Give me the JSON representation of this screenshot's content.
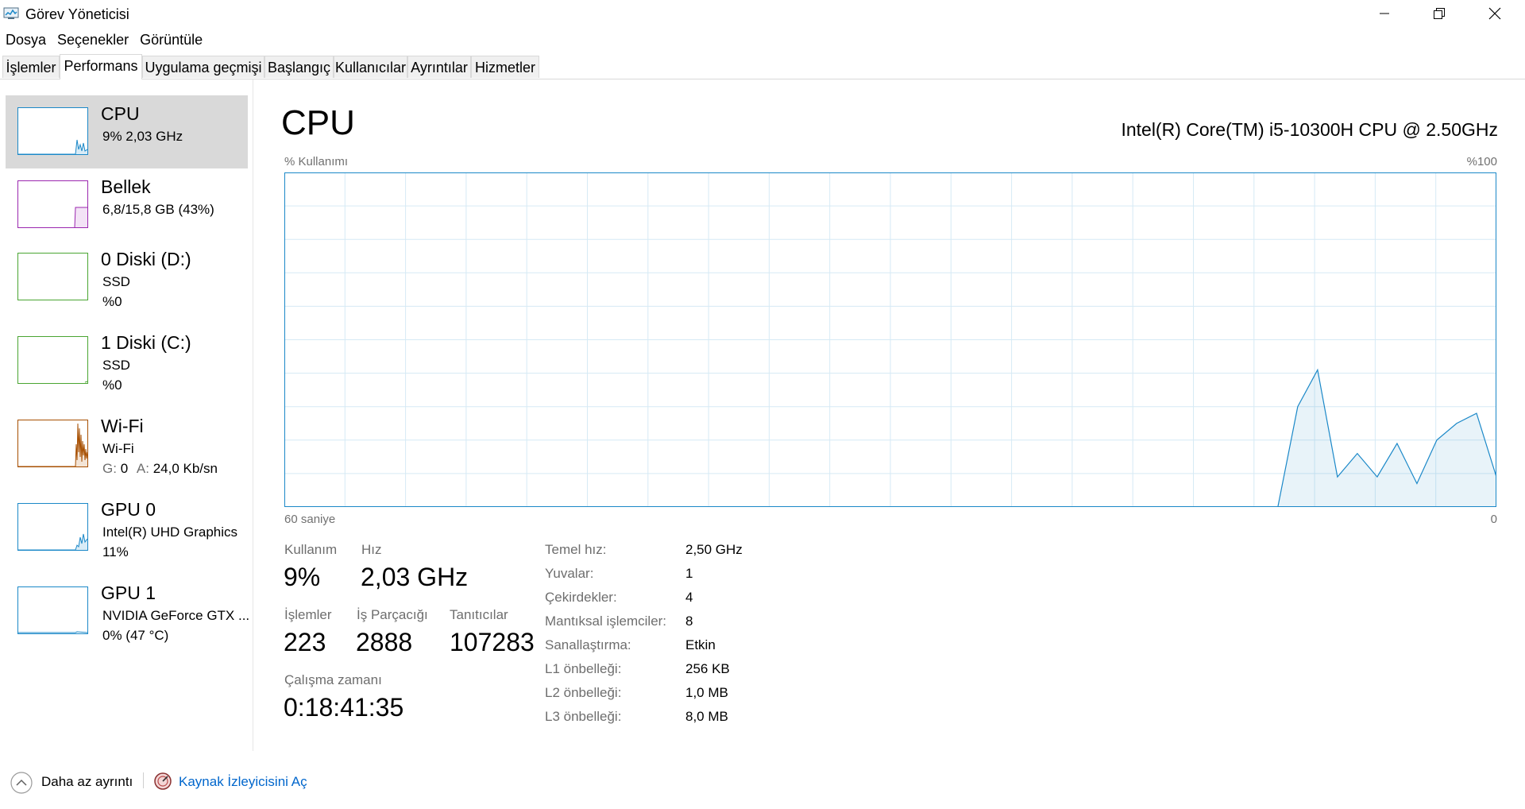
{
  "window": {
    "title": "Görev Yöneticisi",
    "icon": "task-manager-icon"
  },
  "menu": [
    "Dosya",
    "Seçenekler",
    "Görüntüle"
  ],
  "tabs": [
    {
      "label": "İşlemler",
      "active": false
    },
    {
      "label": "Performans",
      "active": true
    },
    {
      "label": "Uygulama geçmişi",
      "active": false
    },
    {
      "label": "Başlangıç",
      "active": false
    },
    {
      "label": "Kullanıcılar",
      "active": false
    },
    {
      "label": "Ayrıntılar",
      "active": false
    },
    {
      "label": "Hizmetler",
      "active": false
    }
  ],
  "sidebar": {
    "items": [
      {
        "title": "CPU",
        "line1": "9%  2,03 GHz",
        "line2": "",
        "color": "#1b88c8",
        "selected": true
      },
      {
        "title": "Bellek",
        "line1": "6,8/15,8 GB (43%)",
        "line2": "",
        "color": "#9b27af",
        "selected": false
      },
      {
        "title": "0 Diski (D:)",
        "line1": "SSD",
        "line2": "%0",
        "color": "#4aa532",
        "selected": false
      },
      {
        "title": "1 Diski (C:)",
        "line1": "SSD",
        "line2": "%0",
        "color": "#4aa532",
        "selected": false
      },
      {
        "title": "Wi-Fi",
        "line1": "Wi-Fi",
        "line2_send_label": "G:",
        "line2_send": "0",
        "line2_recv_label": "A:",
        "line2_recv": "24,0 Kb/sn",
        "color": "#a74f01",
        "selected": false
      },
      {
        "title": "GPU 0",
        "line1": "Intel(R) UHD Graphics",
        "line2": "11%",
        "color": "#1b88c8",
        "selected": false
      },
      {
        "title": "GPU 1",
        "line1": "NVIDIA GeForce GTX ...",
        "line2": "0% (47 °C)",
        "color": "#1b88c8",
        "selected": false
      }
    ]
  },
  "main": {
    "title": "CPU",
    "model": "Intel(R) Core(TM) i5-10300H CPU @ 2.50GHz",
    "y_axis_label": "% Kullanımı",
    "y_axis_max": "%100",
    "x_axis_label": "60 saniye",
    "x_axis_min": "0",
    "accent_color": "#1b88c8",
    "grid_color": "#d6eaf5"
  },
  "chart_data": {
    "type": "area",
    "x": [
      60,
      59,
      58,
      57,
      56,
      55,
      54,
      53,
      52,
      51,
      50,
      49,
      48,
      47,
      46,
      45,
      44,
      43,
      42,
      41,
      40,
      39,
      38,
      37,
      36,
      35,
      34,
      33,
      32,
      31,
      30,
      29,
      28,
      27,
      26,
      25,
      24,
      23,
      22,
      21,
      20,
      19,
      18,
      17,
      16,
      15,
      14,
      13,
      12,
      11,
      10,
      9,
      8,
      7,
      6,
      5,
      4,
      3,
      2,
      1,
      0
    ],
    "values": [
      0,
      0,
      0,
      0,
      0,
      0,
      0,
      0,
      0,
      0,
      0,
      0,
      0,
      0,
      0,
      0,
      0,
      0,
      0,
      0,
      0,
      0,
      0,
      0,
      0,
      0,
      0,
      0,
      0,
      0,
      0,
      0,
      0,
      0,
      0,
      0,
      0,
      0,
      0,
      0,
      0,
      0,
      0,
      0,
      0,
      0,
      0,
      0,
      0,
      0,
      0,
      30,
      41,
      9,
      16,
      9,
      19,
      7,
      20,
      25,
      28,
      9
    ],
    "ylim": [
      0,
      100
    ],
    "xlabel": "60 saniye",
    "ylabel": "% Kullanımı",
    "grid": true
  },
  "stats": {
    "usage_label": "Kullanım",
    "usage": "9%",
    "speed_label": "Hız",
    "speed": "2,03 GHz",
    "processes_label": "İşlemler",
    "processes": "223",
    "threads_label": "İş Parçacığı",
    "threads": "2888",
    "handles_label": "Tanıtıcılar",
    "handles": "107283",
    "uptime_label": "Çalışma zamanı",
    "uptime": "0:18:41:35"
  },
  "specs": [
    {
      "label": "Temel hız:",
      "value": "2,50 GHz"
    },
    {
      "label": "Yuvalar:",
      "value": "1"
    },
    {
      "label": "Çekirdekler:",
      "value": "4"
    },
    {
      "label": "Mantıksal işlemciler:",
      "value": "8"
    },
    {
      "label": "Sanallaştırma:",
      "value": "Etkin"
    },
    {
      "label": "L1 önbelleği:",
      "value": "256 KB"
    },
    {
      "label": "L2 önbelleği:",
      "value": "1,0 MB"
    },
    {
      "label": "L3 önbelleği:",
      "value": "8,0 MB"
    }
  ],
  "footer": {
    "fewer_details": "Daha az ayrıntı",
    "open_monitor": "Kaynak İzleyicisini Aç"
  }
}
